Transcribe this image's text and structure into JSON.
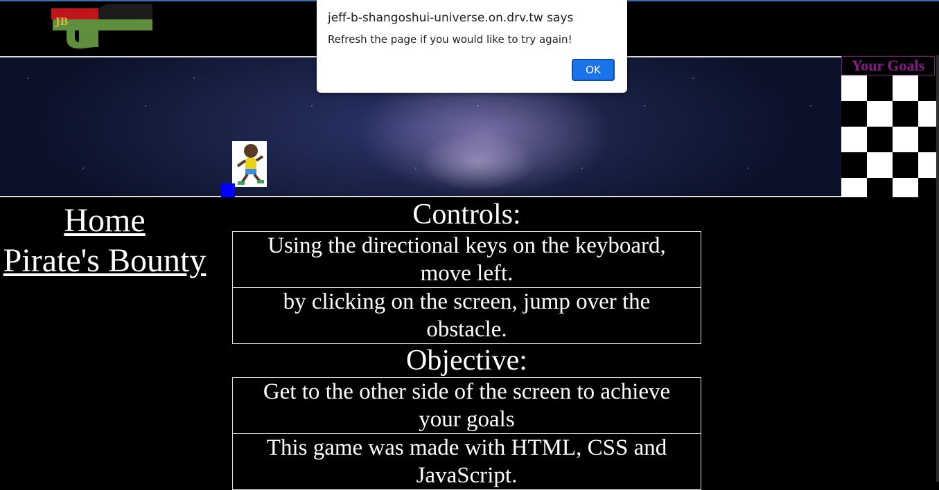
{
  "dialog": {
    "title": "jeff-b-shangoshui-universe.on.drv.tw says",
    "message": "Refresh the page if you would like to try again!",
    "ok_label": "OK"
  },
  "logo": {
    "initials": "JB"
  },
  "nav": {
    "home": "Home",
    "pirates_bounty": "Pirate's Bounty"
  },
  "goals": {
    "title": "Your Goals"
  },
  "controls": {
    "heading": "Controls:",
    "rows": [
      "Using the directional keys on the keyboard, move left.",
      "by clicking on the screen, jump over the obstacle."
    ]
  },
  "objective": {
    "heading": "Objective:",
    "rows": [
      "Get to the other side of the screen to achieve your goals",
      "This game was made with HTML, CSS and JavaScript."
    ]
  },
  "colors": {
    "page_bg": "#000000",
    "goals_title": "#8b1a8b",
    "obstacle": "#0000ff",
    "dialog_button": "#1a73e8"
  }
}
